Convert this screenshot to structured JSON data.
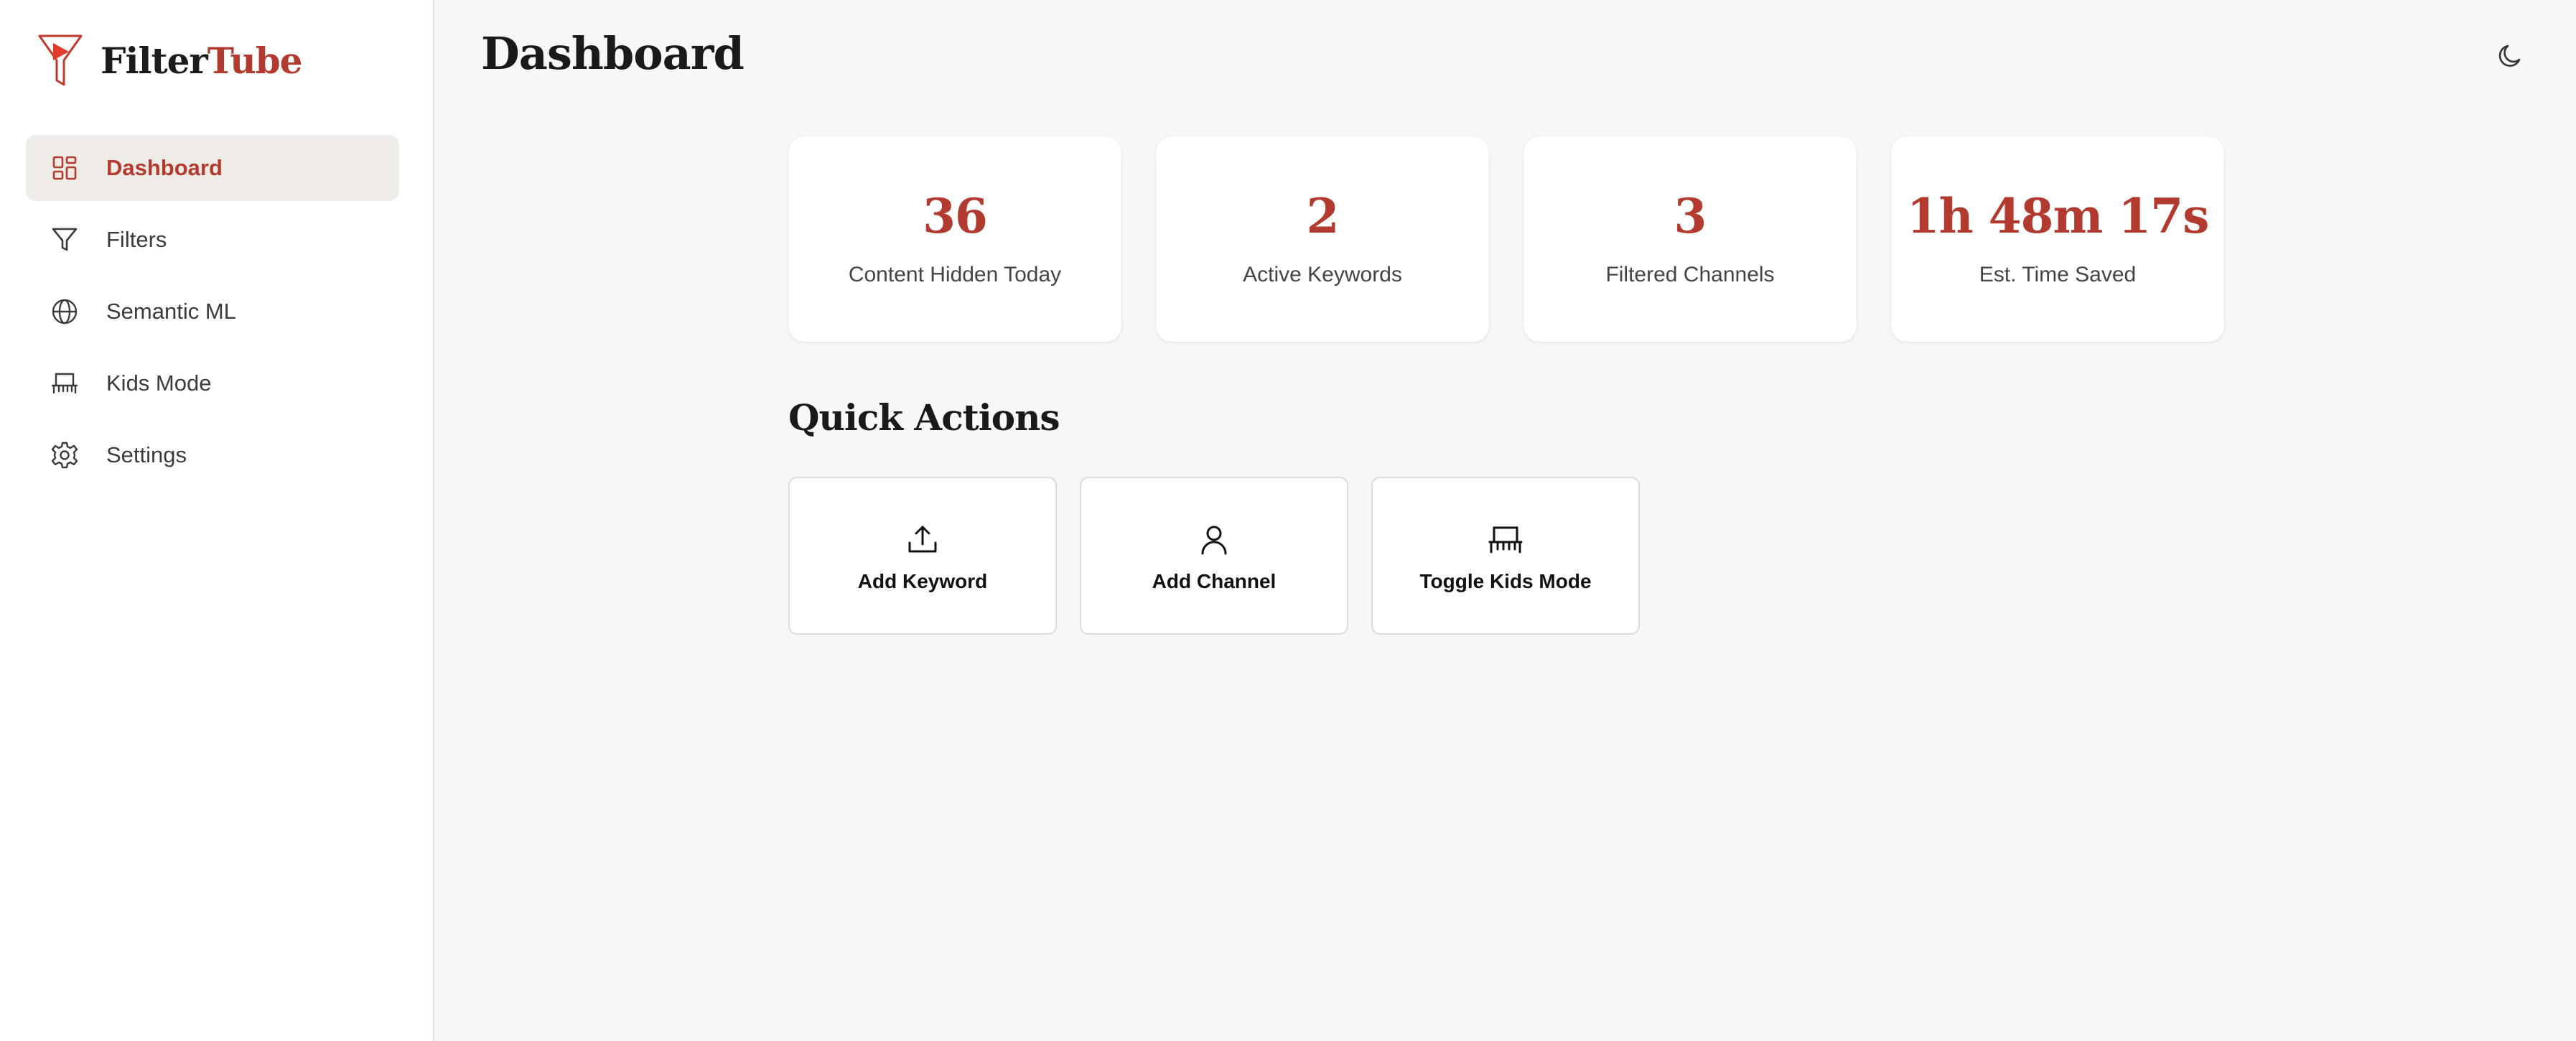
{
  "brand": {
    "name_part1": "Filter",
    "name_part2": "Tube",
    "accent_color": "#b23a2e"
  },
  "sidebar": {
    "items": [
      {
        "label": "Dashboard",
        "icon": "grid-icon",
        "active": true
      },
      {
        "label": "Filters",
        "icon": "funnel-icon",
        "active": false
      },
      {
        "label": "Semantic ML",
        "icon": "globe-icon",
        "active": false
      },
      {
        "label": "Kids Mode",
        "icon": "comb-icon",
        "active": false
      },
      {
        "label": "Settings",
        "icon": "gear-icon",
        "active": false
      }
    ]
  },
  "header": {
    "title": "Dashboard",
    "theme_toggle_icon": "moon-icon"
  },
  "stats": [
    {
      "value": "36",
      "label": "Content Hidden Today"
    },
    {
      "value": "2",
      "label": "Active Keywords"
    },
    {
      "value": "3",
      "label": "Filtered Channels"
    },
    {
      "value": "1h 48m 17s",
      "label": "Est. Time Saved"
    }
  ],
  "quick_actions": {
    "title": "Quick Actions",
    "items": [
      {
        "label": "Add Keyword",
        "icon": "upload-icon"
      },
      {
        "label": "Add Channel",
        "icon": "user-icon"
      },
      {
        "label": "Toggle Kids Mode",
        "icon": "comb-icon"
      }
    ]
  }
}
